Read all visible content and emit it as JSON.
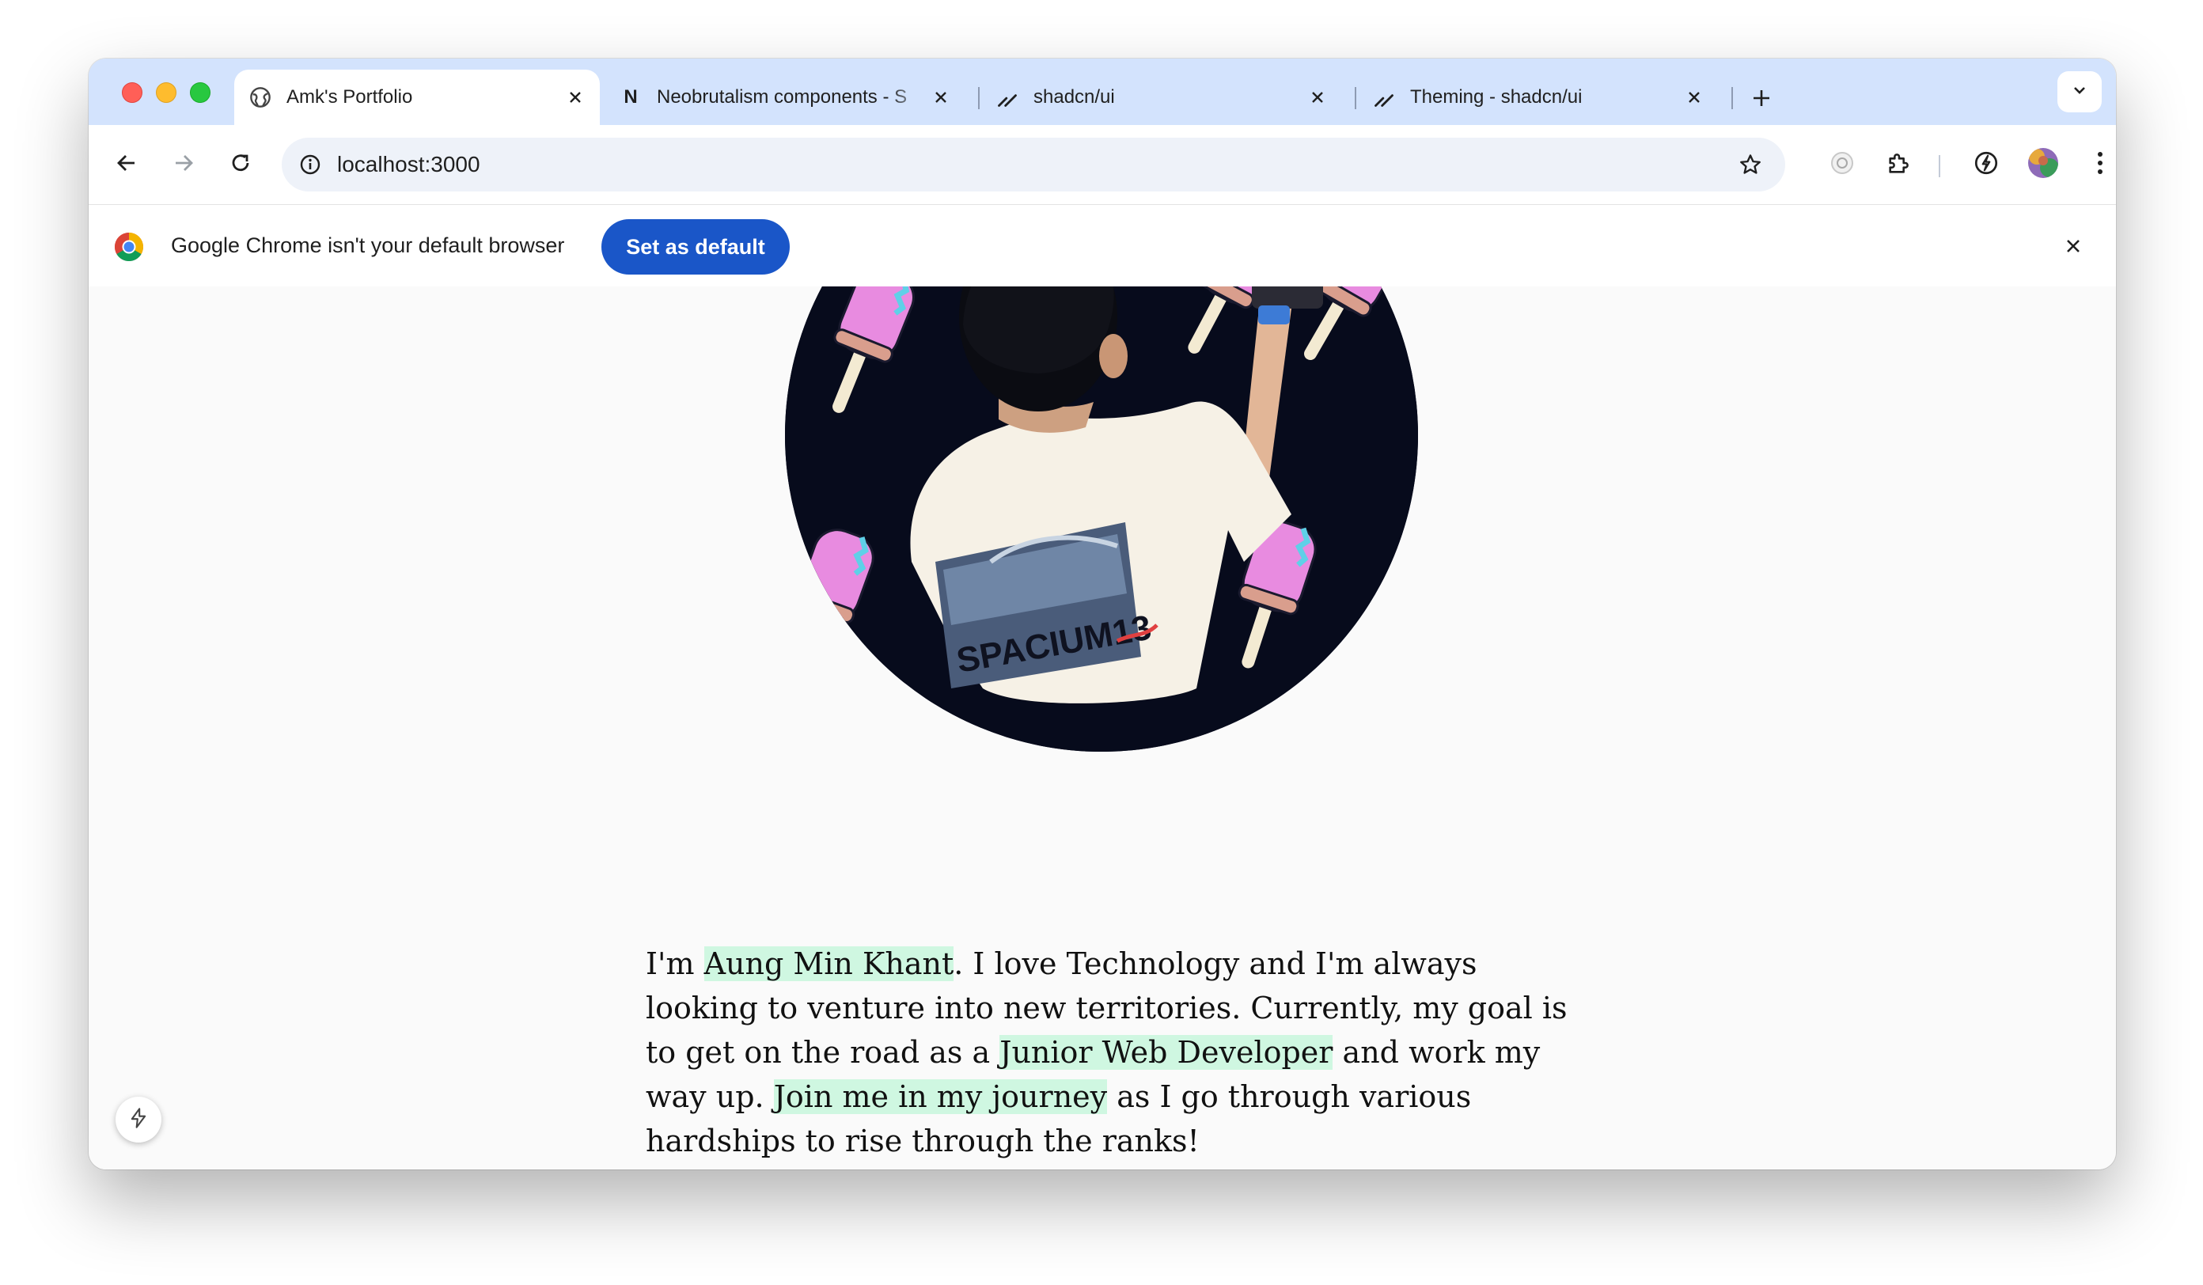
{
  "browser": {
    "tabs": [
      {
        "title": "Amk's Portfolio",
        "icon": "globe-icon",
        "active": true
      },
      {
        "title": "Neobrutalism components - S",
        "icon": "notion-n-icon",
        "active": false
      },
      {
        "title": "shadcn/ui",
        "icon": "shadcn-icon",
        "active": false
      },
      {
        "title": "Theming - shadcn/ui",
        "icon": "shadcn-icon",
        "active": false
      }
    ],
    "url": "localhost:3000",
    "favicon_letter_n": "N"
  },
  "infobar": {
    "message": "Google Chrome isn't your default browser",
    "button_label": "Set as default"
  },
  "colors": {
    "tabstrip": "#d3e3fd",
    "highlight": "#cff7e1",
    "default_button": "#1a56c8",
    "avatar_bg": "#070b1c"
  },
  "page": {
    "bio": {
      "t1": "I'm ",
      "name": "Aung Min Khant",
      "t2": ". I love Technology and I'm always looking to venture into new territories. Currently, my goal is to get on the road as a ",
      "role": "Junior Web Developer",
      "t3": " and work my way up. ",
      "cta": "Join me in my journey",
      "t4": " as I go through various hardships to rise through the ranks!"
    },
    "shirt_text": "SPACIUM13"
  }
}
